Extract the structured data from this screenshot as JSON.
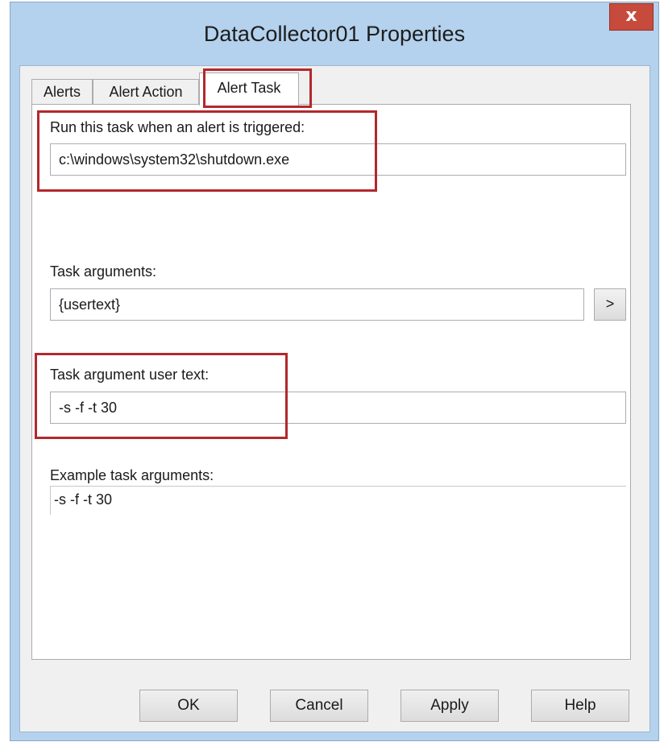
{
  "window": {
    "title": "DataCollector01 Properties",
    "close_glyph": "x"
  },
  "tabs": [
    {
      "label": "Alerts",
      "active": false
    },
    {
      "label": "Alert Action",
      "active": false
    },
    {
      "label": "Alert Task",
      "active": true
    }
  ],
  "alert_task": {
    "run_task_label": "Run this task when an alert is triggered:",
    "run_task_value": "c:\\windows\\system32\\shutdown.exe",
    "task_arguments_label": "Task arguments:",
    "task_arguments_value": "{usertext}",
    "insert_button_label": ">",
    "user_text_label": "Task argument user text:",
    "user_text_value": "-s -f -t 30",
    "example_label": "Example task arguments:",
    "example_value": "-s -f -t 30"
  },
  "buttons": {
    "ok": "OK",
    "cancel": "Cancel",
    "apply": "Apply",
    "help": "Help"
  },
  "colors": {
    "window_frame": "#b4d1ed",
    "close_button": "#c74b3c",
    "highlight_box": "#b3282d"
  },
  "icons": {
    "close": "close-icon"
  }
}
